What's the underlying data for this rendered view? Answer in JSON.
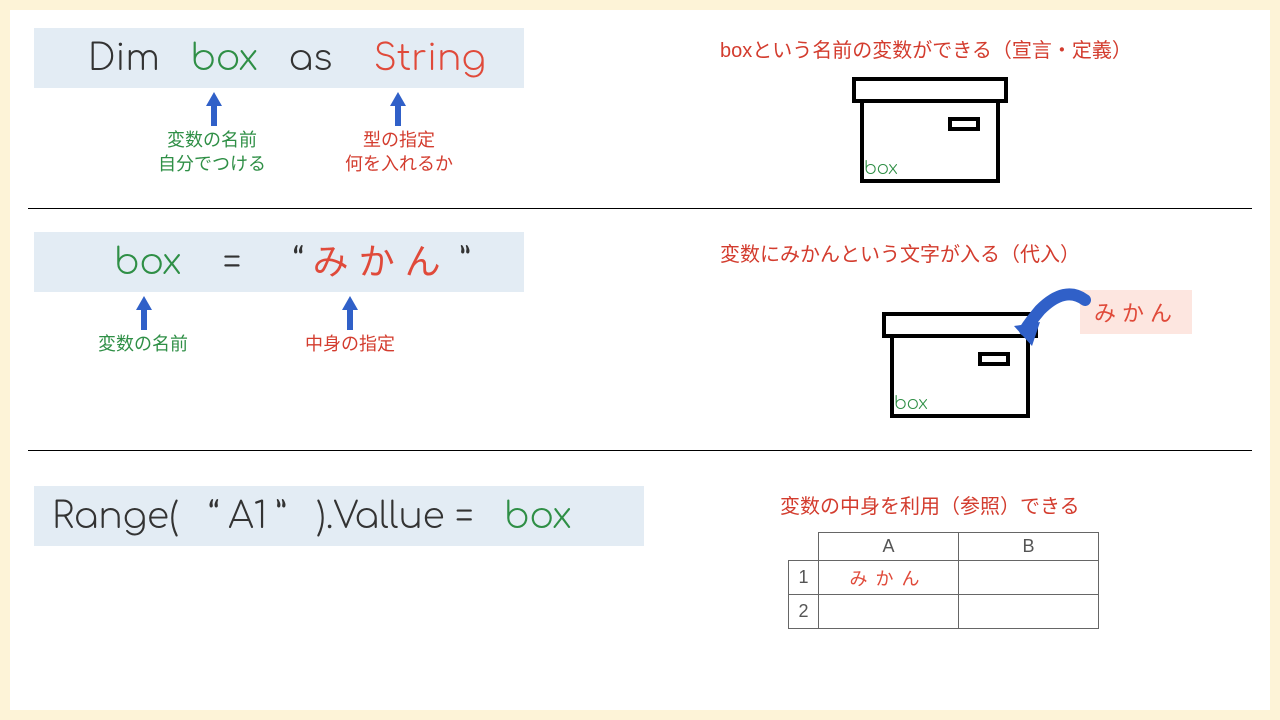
{
  "section1": {
    "code": {
      "dim": "Dim",
      "var": "box",
      "as": "as",
      "type": "String"
    },
    "annot_var_l1": "変数の名前",
    "annot_var_l2": "自分でつける",
    "annot_type_l1": "型の指定",
    "annot_type_l2": "何を入れるか",
    "explain": "boxという名前の変数ができる（宣言・定義）",
    "boxlabel": "box"
  },
  "section2": {
    "code": {
      "var": "box",
      "eq": "=",
      "q1": "“",
      "val": "みかん",
      "q2": "”"
    },
    "annot_var": "変数の名前",
    "annot_val": "中身の指定",
    "explain": "変数にみかんという文字が入る（代入）",
    "boxlabel": "box",
    "flylabel": "みかん"
  },
  "section3": {
    "code": {
      "pre": "Range(",
      "q1": "“",
      "addr": "A1",
      "q2": "”",
      "mid": ").Vallue =",
      "var": "box"
    },
    "explain": "変数の中身を利用（参照）できる",
    "sheet": {
      "cols": [
        "A",
        "B"
      ],
      "rows": [
        "1",
        "2"
      ],
      "a1": "みかん"
    }
  }
}
